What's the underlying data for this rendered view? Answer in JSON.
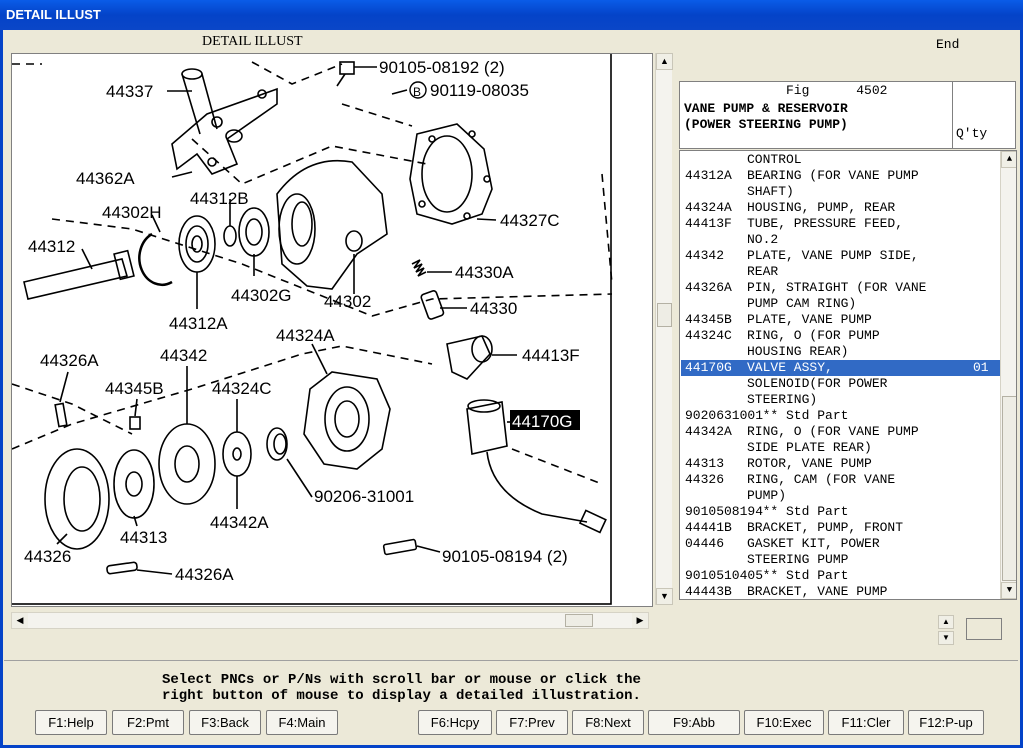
{
  "window": {
    "title": "DETAIL ILLUST"
  },
  "illustration": {
    "title": "DETAIL ILLUST",
    "end_label": "End",
    "callouts": [
      "90105-08192 (2)",
      "B",
      "90119-08035",
      "44337",
      "44362A",
      "44312B",
      "44327C",
      "44302H",
      "44312",
      "44302G",
      "44330A",
      "44302",
      "44330",
      "44312A",
      "44413F",
      "44326A",
      "44342",
      "44324A",
      "44345B",
      "44324C",
      "44170G",
      "90206-31001",
      "44342A",
      "44326",
      "44313",
      "90105-08194 (2)",
      "44326A"
    ]
  },
  "figure": {
    "fig_label": "Fig",
    "fig_number": "4502",
    "description_line1": "VANE PUMP & RESERVOIR",
    "description_line2": "(POWER STEERING PUMP)",
    "qty_header": "Q'ty"
  },
  "parts": [
    {
      "pnc": "",
      "desc": "CONTROL",
      "qty": ""
    },
    {
      "pnc": "44312A",
      "desc": "BEARING (FOR VANE PUMP",
      "qty": ""
    },
    {
      "pnc": "",
      "desc": "SHAFT)",
      "qty": ""
    },
    {
      "pnc": "44324A",
      "desc": "HOUSING, PUMP, REAR",
      "qty": ""
    },
    {
      "pnc": "44413F",
      "desc": "TUBE, PRESSURE FEED,",
      "qty": ""
    },
    {
      "pnc": "",
      "desc": "NO.2",
      "qty": ""
    },
    {
      "pnc": "44342",
      "desc": "PLATE, VANE PUMP SIDE,",
      "qty": ""
    },
    {
      "pnc": "",
      "desc": "REAR",
      "qty": ""
    },
    {
      "pnc": "44326A",
      "desc": "PIN, STRAIGHT (FOR VANE",
      "qty": ""
    },
    {
      "pnc": "",
      "desc": "PUMP CAM RING)",
      "qty": ""
    },
    {
      "pnc": "44345B",
      "desc": "PLATE, VANE PUMP",
      "qty": ""
    },
    {
      "pnc": "44324C",
      "desc": "RING, O (FOR PUMP",
      "qty": ""
    },
    {
      "pnc": "",
      "desc": "HOUSING REAR)",
      "qty": ""
    },
    {
      "pnc": "44170G",
      "desc": "VALVE ASSY,",
      "qty": "01",
      "selected": true
    },
    {
      "pnc": "",
      "desc": "SOLENOID(FOR POWER",
      "qty": ""
    },
    {
      "pnc": "",
      "desc": "STEERING)",
      "qty": ""
    },
    {
      "pnc": "9020631001",
      "desc": "  ** Std Part",
      "qty": ""
    },
    {
      "pnc": "44342A",
      "desc": "RING, O (FOR VANE PUMP",
      "qty": ""
    },
    {
      "pnc": "",
      "desc": "SIDE PLATE REAR)",
      "qty": ""
    },
    {
      "pnc": "44313",
      "desc": "ROTOR, VANE PUMP",
      "qty": ""
    },
    {
      "pnc": "44326",
      "desc": "RING, CAM (FOR VANE",
      "qty": ""
    },
    {
      "pnc": "",
      "desc": "PUMP)",
      "qty": ""
    },
    {
      "pnc": "9010508194",
      "desc": "  ** Std Part",
      "qty": ""
    },
    {
      "pnc": "44441B",
      "desc": "BRACKET, PUMP, FRONT",
      "qty": ""
    },
    {
      "pnc": "04446",
      "desc": "GASKET KIT, POWER",
      "qty": ""
    },
    {
      "pnc": "",
      "desc": "STEERING PUMP",
      "qty": ""
    },
    {
      "pnc": "9010510405",
      "desc": "  ** Std Part",
      "qty": ""
    },
    {
      "pnc": "44443B",
      "desc": "BRACKET, VANE PUMP",
      "qty": ""
    }
  ],
  "status": {
    "line1": "Select PNCs or P/Ns with scroll bar or mouse or click the",
    "line2": "right button of mouse to display a detailed illustration."
  },
  "function_keys": [
    "F1:Help",
    "F2:Pmt",
    "F3:Back",
    "F4:Main",
    "F6:Hcpy",
    "F7:Prev",
    "F8:Next",
    "F9:Abb",
    "F10:Exec",
    "F11:Cler",
    "F12:P-up"
  ],
  "colors": {
    "titlebar": "#0443c8",
    "selection": "#316ac5",
    "face": "#ece9d8"
  }
}
